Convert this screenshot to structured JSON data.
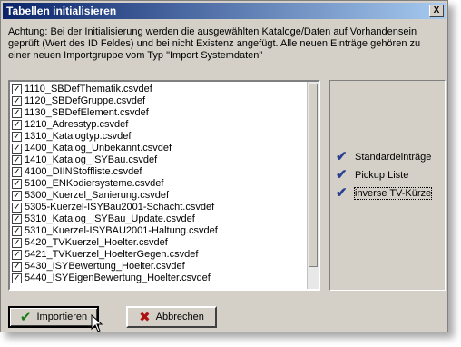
{
  "window": {
    "title": "Tabellen initialisieren",
    "close_label": "X"
  },
  "description": [
    "Achtung: Bei der Initialisierung werden die ausgewählten Kataloge/Daten auf Vorhandensein",
    "geprüft (Wert des ID Feldes) und bei nicht Existenz angefügt. Alle neuen Einträge gehören zu",
    "einer neuen Importgruppe vom Typ \"Import Systemdaten\""
  ],
  "file_list": [
    {
      "label": "1110_SBDefThematik.csvdef",
      "checked": true
    },
    {
      "label": "1120_SBDefGruppe.csvdef",
      "checked": true
    },
    {
      "label": "1130_SBDefElement.csvdef",
      "checked": true
    },
    {
      "label": "1210_Adresstyp.csvdef",
      "checked": true
    },
    {
      "label": "1310_Katalogtyp.csvdef",
      "checked": true
    },
    {
      "label": "1400_Katalog_Unbekannt.csvdef",
      "checked": true
    },
    {
      "label": "1410_Katalog_ISYBau.csvdef",
      "checked": true
    },
    {
      "label": "4100_DIINStoffliste.csvdef",
      "checked": true
    },
    {
      "label": "5100_ENKodiersysteme.csvdef",
      "checked": true
    },
    {
      "label": "5300_Kuerzel_Sanierung.csvdef",
      "checked": true
    },
    {
      "label": "5305-Kuerzel-ISYBau2001-Schacht.csvdef",
      "checked": true
    },
    {
      "label": "5310_Katalog_ISYBau_Update.csvdef",
      "checked": true
    },
    {
      "label": "5310_Kuerzel-ISYBAU2001-Haltung.csvdef",
      "checked": true
    },
    {
      "label": "5420_TVKuerzel_Hoelter.csvdef",
      "checked": true
    },
    {
      "label": "5421_TVKuerzel_HoelterGegen.csvdef",
      "checked": true
    },
    {
      "label": "5430_ISYBewertung_Hoelter.csvdef",
      "checked": true
    },
    {
      "label": "5440_ISYEigenBewertung_Hoelter.csvdef",
      "checked": true
    }
  ],
  "options": [
    {
      "label": "Standardeinträge",
      "checked": true
    },
    {
      "label": "Pickup Liste",
      "checked": true
    },
    {
      "label": "inverse TV-Kürze",
      "checked": true
    }
  ],
  "buttons": {
    "import_label": "Importieren",
    "cancel_label": "Abbrechen"
  },
  "colors": {
    "titlebar_start": "#0a246a",
    "titlebar_end": "#a6caf0",
    "dialog_bg": "#d4d0c8"
  }
}
